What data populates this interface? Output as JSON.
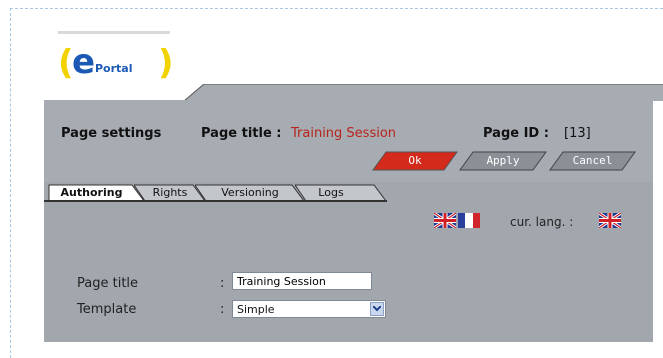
{
  "logo": {
    "mark": "e",
    "word": "Portal"
  },
  "header": {
    "page_settings_label": "Page settings",
    "page_title_label": "Page title :",
    "page_title_value": "Training Session",
    "page_id_label": "Page ID :",
    "page_id_value": "[13]"
  },
  "buttons": {
    "ok": "Ok",
    "apply": "Apply",
    "cancel": "Cancel"
  },
  "tabs": [
    {
      "label": "Authoring",
      "active": true
    },
    {
      "label": "Rights",
      "active": false
    },
    {
      "label": "Versioning",
      "active": false
    },
    {
      "label": "Logs",
      "active": false
    }
  ],
  "language": {
    "current_label": "cur. lang. :",
    "flags": [
      "uk-flag-icon",
      "france-flag-icon"
    ],
    "current_flag": "uk-flag-icon"
  },
  "form": {
    "page_title_label": "Page title",
    "template_label": "Template",
    "colon": ":",
    "page_title_value": "Training Session",
    "template_value": "Simple"
  },
  "colors": {
    "accent_red": "#d42a1c",
    "panel_gray": "#a1a7ad",
    "button_gray": "#8a9096",
    "title_red": "#b8231b",
    "dash_blue": "#a9c6e2"
  }
}
